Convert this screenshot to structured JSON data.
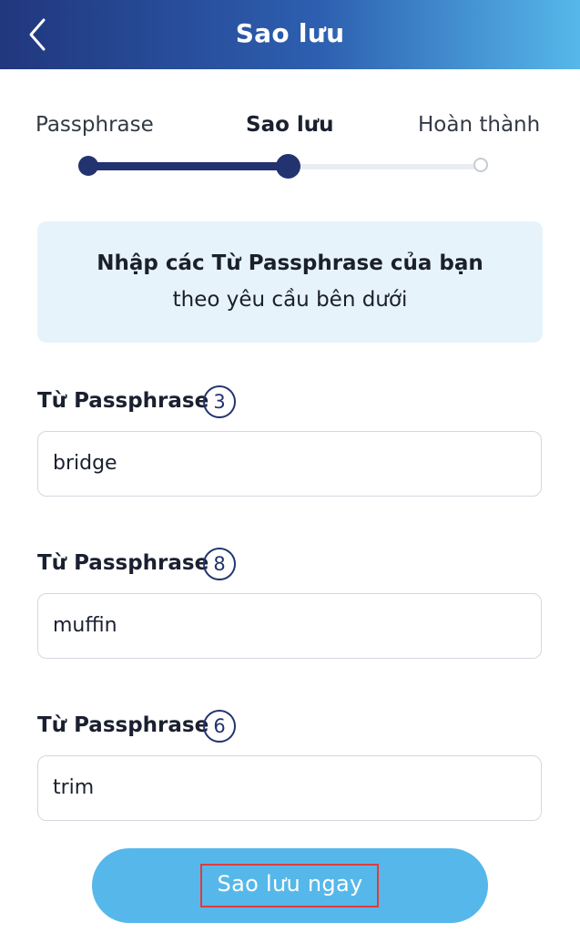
{
  "header": {
    "title": "Sao lưu",
    "back_icon": "chevron-left-icon"
  },
  "stepper": {
    "steps": [
      {
        "label": "Passphrase",
        "state": "done"
      },
      {
        "label": "Sao lưu",
        "state": "current"
      },
      {
        "label": "Hoàn thành",
        "state": "pending"
      }
    ]
  },
  "instruction": {
    "line1": "Nhập các Từ Passphrase của bạn",
    "line2": "theo yêu cầu bên dưới"
  },
  "fields": [
    {
      "label": "Từ Passphrase",
      "number": "3",
      "value": "bridge"
    },
    {
      "label": "Từ Passphrase",
      "number": "8",
      "value": "muffin"
    },
    {
      "label": "Từ Passphrase",
      "number": "6",
      "value": "trim"
    }
  ],
  "submit": {
    "label": "Sao lưu ngay"
  },
  "colors": {
    "header_start": "#21377e",
    "header_end": "#56b8ea",
    "accent": "#22336f",
    "button": "#56b8ea",
    "highlight": "#e23b3b"
  }
}
